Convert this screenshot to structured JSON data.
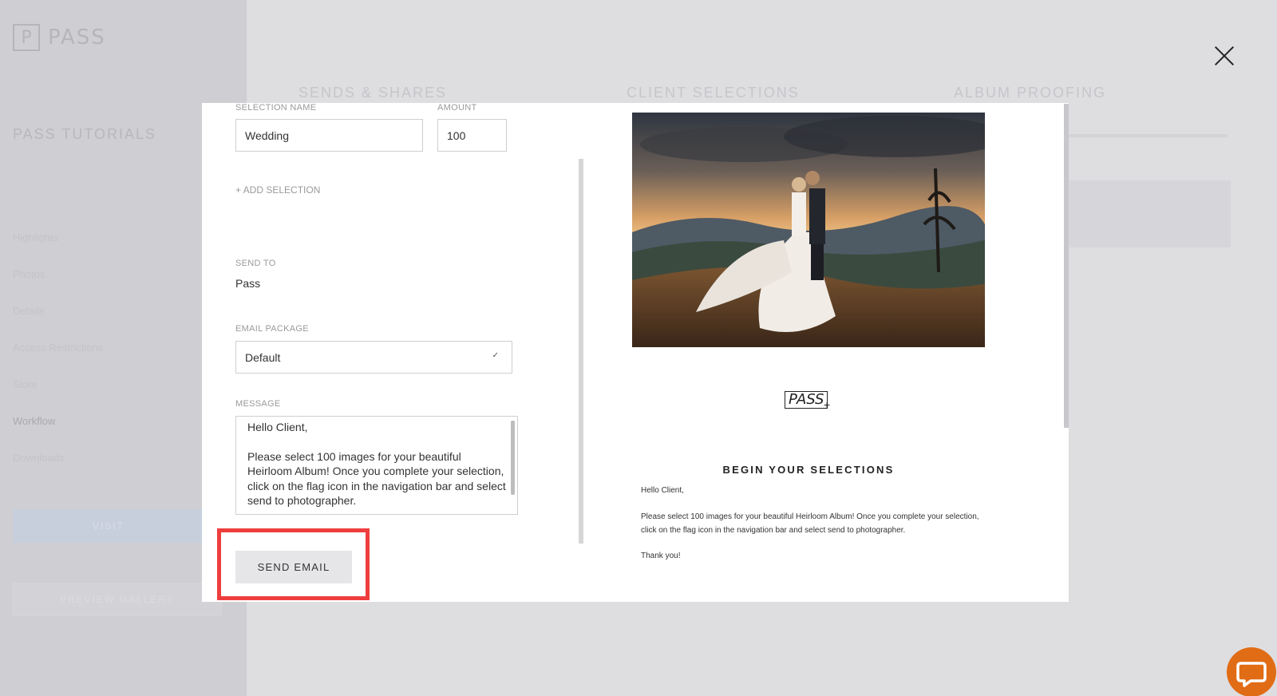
{
  "app": {
    "brand_letter": "P",
    "brand_name": "PASS",
    "account_name": "PASS TUTORIALS",
    "nav_items": [
      "Highlights",
      "Photos",
      "Details",
      "Access Restrictions",
      "Store",
      "Workflow",
      "Downloads"
    ],
    "active_nav": "Workflow",
    "primary_button": "VISIT",
    "preview_button": "PREVIEW GALLERY",
    "tabs": [
      "SENDS & SHARES",
      "CLIENT SELECTIONS",
      "ALBUM PROOFING"
    ]
  },
  "modal": {
    "selection_name_label": "SELECTION NAME",
    "selection_name_value": "Wedding",
    "amount_label": "AMOUNT",
    "amount_value": "100",
    "add_selection": "+ ADD SELECTION",
    "send_to_label": "SEND TO",
    "send_to_value": "Pass",
    "email_package_label": "EMAIL PACKAGE",
    "email_package_value": "Default",
    "message_label": "MESSAGE",
    "message_greeting": "Hello Client,",
    "message_body": "Please select 100 images for your beautiful Heirloom Album! Once you complete your selection, click on the flag icon in the navigation bar and select send to photographer.",
    "send_button": "SEND EMAIL"
  },
  "preview": {
    "logo_text": "PASS",
    "heading": "BEGIN YOUR SELECTIONS",
    "greeting": "Hello Client,",
    "body": "Please select 100 images for your beautiful Heirloom Album! Once you complete your selection, click on the flag icon in the navigation bar and select send to photographer.",
    "signoff": "Thank you!"
  },
  "colors": {
    "highlight": "#ef3e3e",
    "chat_accent": "#e16c16",
    "overlay": "#d9d9dc"
  }
}
